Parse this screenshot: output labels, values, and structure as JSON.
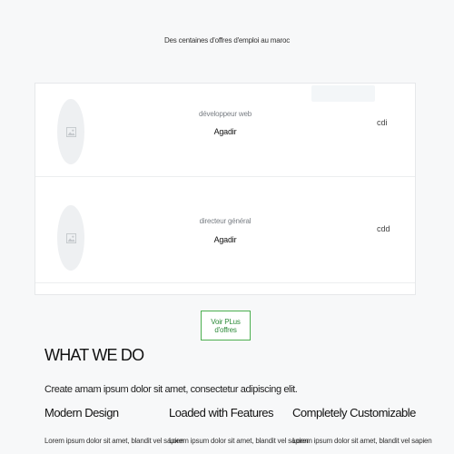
{
  "hero": {
    "tagline": "Des centaines d'offres d'emploi au maroc"
  },
  "jobs": [
    {
      "title": "développeur web",
      "city": "Agadir",
      "contract": "cdi",
      "logo_icon": "image-placeholder-icon"
    },
    {
      "title": "directeur général",
      "city": "Agadir",
      "contract": "cdd",
      "logo_icon": "image-placeholder-icon"
    }
  ],
  "more_button": {
    "label": "Voir PLus d'offres"
  },
  "what_we_do": {
    "title": "WHAT WE DO",
    "intro": "Create amam ipsum dolor sit amet, consectetur adipiscing elit.",
    "features": [
      {
        "title": "Modern Design",
        "text": "Lorem ipsum dolor sit amet, blandit vel sapien"
      },
      {
        "title": "Loaded with Features",
        "text": "Lorem ipsum dolor sit amet, blandit vel sapien"
      },
      {
        "title": "Completely Customizable",
        "text": "Lorem ipsum dolor sit amet, blandit vel sapien"
      }
    ]
  },
  "colors": {
    "page_bg": "#f7f8f9",
    "accent_green": "#4caf50",
    "card_bg": "#ffffff"
  }
}
